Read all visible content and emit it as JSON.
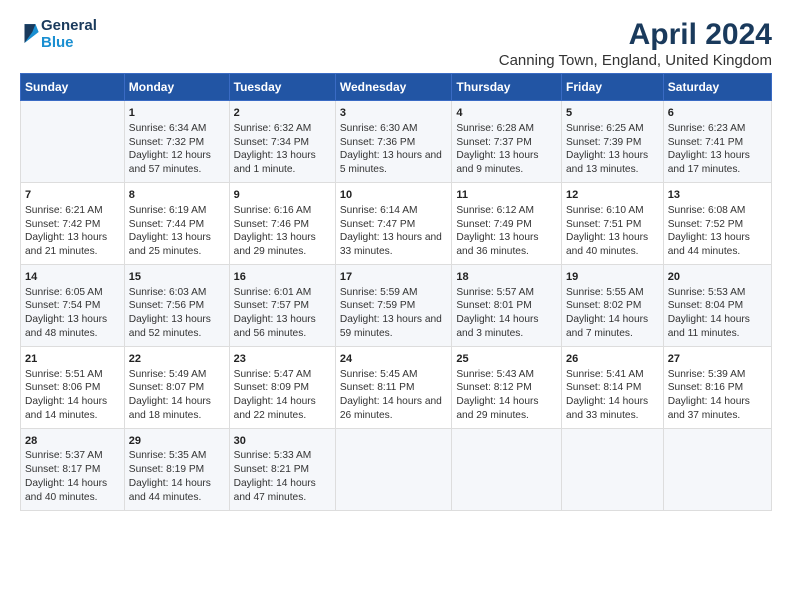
{
  "header": {
    "logo_line1": "General",
    "logo_line2": "Blue",
    "title": "April 2024",
    "subtitle": "Canning Town, England, United Kingdom"
  },
  "columns": [
    "Sunday",
    "Monday",
    "Tuesday",
    "Wednesday",
    "Thursday",
    "Friday",
    "Saturday"
  ],
  "weeks": [
    [
      {
        "day": "",
        "sunrise": "",
        "sunset": "",
        "daylight": ""
      },
      {
        "day": "1",
        "sunrise": "Sunrise: 6:34 AM",
        "sunset": "Sunset: 7:32 PM",
        "daylight": "Daylight: 12 hours and 57 minutes."
      },
      {
        "day": "2",
        "sunrise": "Sunrise: 6:32 AM",
        "sunset": "Sunset: 7:34 PM",
        "daylight": "Daylight: 13 hours and 1 minute."
      },
      {
        "day": "3",
        "sunrise": "Sunrise: 6:30 AM",
        "sunset": "Sunset: 7:36 PM",
        "daylight": "Daylight: 13 hours and 5 minutes."
      },
      {
        "day": "4",
        "sunrise": "Sunrise: 6:28 AM",
        "sunset": "Sunset: 7:37 PM",
        "daylight": "Daylight: 13 hours and 9 minutes."
      },
      {
        "day": "5",
        "sunrise": "Sunrise: 6:25 AM",
        "sunset": "Sunset: 7:39 PM",
        "daylight": "Daylight: 13 hours and 13 minutes."
      },
      {
        "day": "6",
        "sunrise": "Sunrise: 6:23 AM",
        "sunset": "Sunset: 7:41 PM",
        "daylight": "Daylight: 13 hours and 17 minutes."
      }
    ],
    [
      {
        "day": "7",
        "sunrise": "Sunrise: 6:21 AM",
        "sunset": "Sunset: 7:42 PM",
        "daylight": "Daylight: 13 hours and 21 minutes."
      },
      {
        "day": "8",
        "sunrise": "Sunrise: 6:19 AM",
        "sunset": "Sunset: 7:44 PM",
        "daylight": "Daylight: 13 hours and 25 minutes."
      },
      {
        "day": "9",
        "sunrise": "Sunrise: 6:16 AM",
        "sunset": "Sunset: 7:46 PM",
        "daylight": "Daylight: 13 hours and 29 minutes."
      },
      {
        "day": "10",
        "sunrise": "Sunrise: 6:14 AM",
        "sunset": "Sunset: 7:47 PM",
        "daylight": "Daylight: 13 hours and 33 minutes."
      },
      {
        "day": "11",
        "sunrise": "Sunrise: 6:12 AM",
        "sunset": "Sunset: 7:49 PM",
        "daylight": "Daylight: 13 hours and 36 minutes."
      },
      {
        "day": "12",
        "sunrise": "Sunrise: 6:10 AM",
        "sunset": "Sunset: 7:51 PM",
        "daylight": "Daylight: 13 hours and 40 minutes."
      },
      {
        "day": "13",
        "sunrise": "Sunrise: 6:08 AM",
        "sunset": "Sunset: 7:52 PM",
        "daylight": "Daylight: 13 hours and 44 minutes."
      }
    ],
    [
      {
        "day": "14",
        "sunrise": "Sunrise: 6:05 AM",
        "sunset": "Sunset: 7:54 PM",
        "daylight": "Daylight: 13 hours and 48 minutes."
      },
      {
        "day": "15",
        "sunrise": "Sunrise: 6:03 AM",
        "sunset": "Sunset: 7:56 PM",
        "daylight": "Daylight: 13 hours and 52 minutes."
      },
      {
        "day": "16",
        "sunrise": "Sunrise: 6:01 AM",
        "sunset": "Sunset: 7:57 PM",
        "daylight": "Daylight: 13 hours and 56 minutes."
      },
      {
        "day": "17",
        "sunrise": "Sunrise: 5:59 AM",
        "sunset": "Sunset: 7:59 PM",
        "daylight": "Daylight: 13 hours and 59 minutes."
      },
      {
        "day": "18",
        "sunrise": "Sunrise: 5:57 AM",
        "sunset": "Sunset: 8:01 PM",
        "daylight": "Daylight: 14 hours and 3 minutes."
      },
      {
        "day": "19",
        "sunrise": "Sunrise: 5:55 AM",
        "sunset": "Sunset: 8:02 PM",
        "daylight": "Daylight: 14 hours and 7 minutes."
      },
      {
        "day": "20",
        "sunrise": "Sunrise: 5:53 AM",
        "sunset": "Sunset: 8:04 PM",
        "daylight": "Daylight: 14 hours and 11 minutes."
      }
    ],
    [
      {
        "day": "21",
        "sunrise": "Sunrise: 5:51 AM",
        "sunset": "Sunset: 8:06 PM",
        "daylight": "Daylight: 14 hours and 14 minutes."
      },
      {
        "day": "22",
        "sunrise": "Sunrise: 5:49 AM",
        "sunset": "Sunset: 8:07 PM",
        "daylight": "Daylight: 14 hours and 18 minutes."
      },
      {
        "day": "23",
        "sunrise": "Sunrise: 5:47 AM",
        "sunset": "Sunset: 8:09 PM",
        "daylight": "Daylight: 14 hours and 22 minutes."
      },
      {
        "day": "24",
        "sunrise": "Sunrise: 5:45 AM",
        "sunset": "Sunset: 8:11 PM",
        "daylight": "Daylight: 14 hours and 26 minutes."
      },
      {
        "day": "25",
        "sunrise": "Sunrise: 5:43 AM",
        "sunset": "Sunset: 8:12 PM",
        "daylight": "Daylight: 14 hours and 29 minutes."
      },
      {
        "day": "26",
        "sunrise": "Sunrise: 5:41 AM",
        "sunset": "Sunset: 8:14 PM",
        "daylight": "Daylight: 14 hours and 33 minutes."
      },
      {
        "day": "27",
        "sunrise": "Sunrise: 5:39 AM",
        "sunset": "Sunset: 8:16 PM",
        "daylight": "Daylight: 14 hours and 37 minutes."
      }
    ],
    [
      {
        "day": "28",
        "sunrise": "Sunrise: 5:37 AM",
        "sunset": "Sunset: 8:17 PM",
        "daylight": "Daylight: 14 hours and 40 minutes."
      },
      {
        "day": "29",
        "sunrise": "Sunrise: 5:35 AM",
        "sunset": "Sunset: 8:19 PM",
        "daylight": "Daylight: 14 hours and 44 minutes."
      },
      {
        "day": "30",
        "sunrise": "Sunrise: 5:33 AM",
        "sunset": "Sunset: 8:21 PM",
        "daylight": "Daylight: 14 hours and 47 minutes."
      },
      {
        "day": "",
        "sunrise": "",
        "sunset": "",
        "daylight": ""
      },
      {
        "day": "",
        "sunrise": "",
        "sunset": "",
        "daylight": ""
      },
      {
        "day": "",
        "sunrise": "",
        "sunset": "",
        "daylight": ""
      },
      {
        "day": "",
        "sunrise": "",
        "sunset": "",
        "daylight": ""
      }
    ]
  ]
}
